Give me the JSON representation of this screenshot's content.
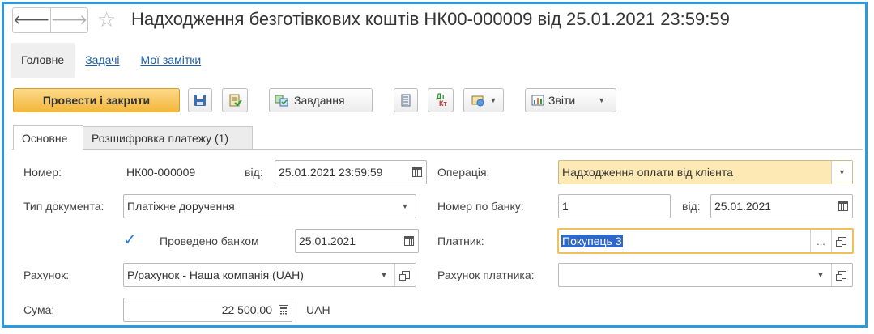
{
  "window": {
    "title": "Надходження безготівкових коштів НК00-000009 від 25.01.2021 23:59:59",
    "back_glyph": "🡐",
    "forward_glyph": "🡒",
    "star_glyph": "☆"
  },
  "nav": {
    "items": [
      {
        "label": "Головне"
      },
      {
        "label": "Задачі"
      },
      {
        "label": "Мої замітки"
      }
    ]
  },
  "toolbar": {
    "post_close_label": "Провести і закрити",
    "tasks_label": "Завдання",
    "reports_label": "Звіти",
    "dtkt_top": "Дт",
    "dtkt_bottom": "Кт"
  },
  "tabs": [
    {
      "label": "Основне"
    },
    {
      "label": "Розшифровка платежу (1)"
    }
  ],
  "form": {
    "number_label": "Номер:",
    "number_value": "НК00-000009",
    "from_label": "від:",
    "date_value": "25.01.2021 23:59:59",
    "operation_label": "Операція:",
    "operation_value": "Надходження оплати від клієнта",
    "doc_type_label": "Тип документа:",
    "doc_type_value": "Платіжне доручення",
    "bank_number_label": "Номер по банку:",
    "bank_number_value": "1",
    "bank_from_label": "від:",
    "bank_date_value": "25.01.2021",
    "posted_label": "Проведено банком",
    "posted_checked": true,
    "posted_date_value": "25.01.2021",
    "payer_label": "Платник:",
    "payer_value": "Покупець 3",
    "account_label": "Рахунок:",
    "account_value": "Р/рахунок - Наша компанія (UAH)",
    "payer_account_label": "Рахунок платника:",
    "payer_account_value": "",
    "amount_label": "Сума:",
    "amount_value": "22 500,00",
    "currency": "UAH",
    "ellipsis": "...",
    "checkmark": "✓"
  },
  "colors": {
    "frame": "#2a9be0",
    "primary_button": "#f3b73c",
    "operation_highlight": "#fce9b3",
    "selection": "#2f67c9",
    "link": "#1c5ea8"
  },
  "icons": [
    "back-arrow-icon",
    "forward-arrow-icon",
    "star-icon",
    "save-icon",
    "post-icon",
    "tasks-icon",
    "list-icon",
    "dt-kt-icon",
    "print-icon",
    "reports-icon",
    "calendar-icon",
    "dropdown-icon",
    "open-icon",
    "calculator-icon"
  ]
}
